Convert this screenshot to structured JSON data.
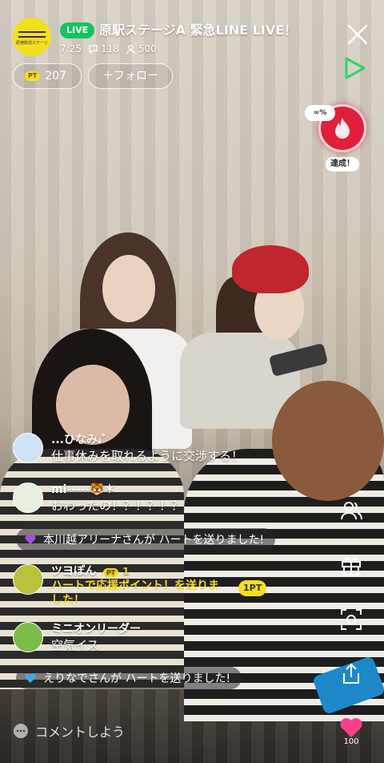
{
  "header": {
    "live_badge": "LIVE",
    "channel_title": "原駅ステージA 緊急LINE LIVE！",
    "elapsed_time": "7:25",
    "comment_count": "118",
    "viewer_count": "500",
    "avatar_logo_text": "原宿駅前ステージ"
  },
  "points": {
    "badge": "PT",
    "value": "207"
  },
  "follow": {
    "label": "＋フォロー"
  },
  "mission": {
    "percent": "∞%",
    "status": "達成！"
  },
  "comments": [
    {
      "name": "...ひなみ𝓈゜",
      "text": "仕事休みを取れるように交渉する！",
      "avatar_color": "#cfe3f5"
    },
    {
      "name": "mi-----🐯＊",
      "text": "おわったの！？！？！？",
      "avatar_color": "#e8f0e0"
    },
    {
      "name": "ツヨぽん",
      "badge": "PT",
      "badge_value": "1",
      "text_line1": "ハートで応援ポイント！を送りま",
      "text_line2": "した！",
      "points": "1PT",
      "avatar_color": "#b9c23a"
    },
    {
      "name": "ミニオンリーダー",
      "text": "空気イス",
      "avatar_color": "#7cbd4a"
    }
  ],
  "heart_notifications": [
    {
      "text": "本川越アリーナさんが ハートを送りました!",
      "color": "#a34ee0"
    },
    {
      "text": "えりなでさんが ハートを送りました!",
      "color": "#3fa8e8"
    }
  ],
  "side_icons": [
    "people-icon",
    "gift-icon",
    "camera-switch-icon",
    "share-icon"
  ],
  "bottom": {
    "comment_placeholder": "コメントしよう",
    "heart_count": "100",
    "heart_color": "#ff3f8a"
  }
}
